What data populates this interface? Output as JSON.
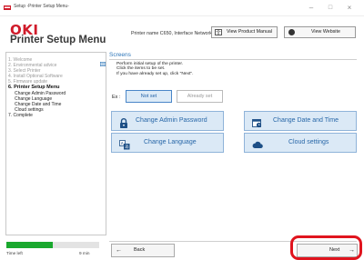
{
  "window": {
    "title": "Setup -Printer Setup Menu-",
    "min_glyph": "–",
    "max_glyph": "□",
    "close_glyph": "×"
  },
  "header": {
    "logo_text": "OKI",
    "app_name": "Printer Setup Menu",
    "printer_info": "Printer name C650, Interface Network",
    "view_manual_label": "View Product Manual",
    "view_website_label": "View Website"
  },
  "sidebar": {
    "items": [
      {
        "label": "1. Welcome",
        "state": "done"
      },
      {
        "label": "2. Environmental advice",
        "state": "done"
      },
      {
        "label": "3. Select Printer",
        "state": "done"
      },
      {
        "label": "4. Install Optional Software",
        "state": "done"
      },
      {
        "label": "5. Firmware update",
        "state": "done"
      },
      {
        "label": "6. Printer Setup Menu",
        "state": "active"
      },
      {
        "label": "Change Admin Password",
        "state": "sub"
      },
      {
        "label": "Change Language",
        "state": "sub"
      },
      {
        "label": "Change Date and Time",
        "state": "sub"
      },
      {
        "label": "Cloud settings",
        "state": "sub"
      },
      {
        "label": "7. Complete",
        "state": "future"
      }
    ],
    "progress_fraction": 0.5,
    "time_left_label": "Time left",
    "time_left_value": "9 min"
  },
  "main": {
    "section_title": "Screens",
    "instructions": [
      "Perform initial setup of the printer.",
      "Click the items to be set.",
      "If you have already set up, click \"Next\"."
    ],
    "ex_label": "Ex :",
    "not_set_label": "Not set",
    "already_set_label": "Already set",
    "actions": {
      "admin_password": "Change Admin Password",
      "date_time": "Change Date and Time",
      "language": "Change Language",
      "cloud": "Cloud settings"
    }
  },
  "footer": {
    "back_label": "Back",
    "next_label": "Next",
    "back_arrow": "←",
    "next_arrow": "→"
  },
  "colors": {
    "brand_red": "#d01b2a",
    "accent_blue": "#2b74b8",
    "progress_green": "#1aa82e",
    "highlight_red": "#e0141e"
  }
}
